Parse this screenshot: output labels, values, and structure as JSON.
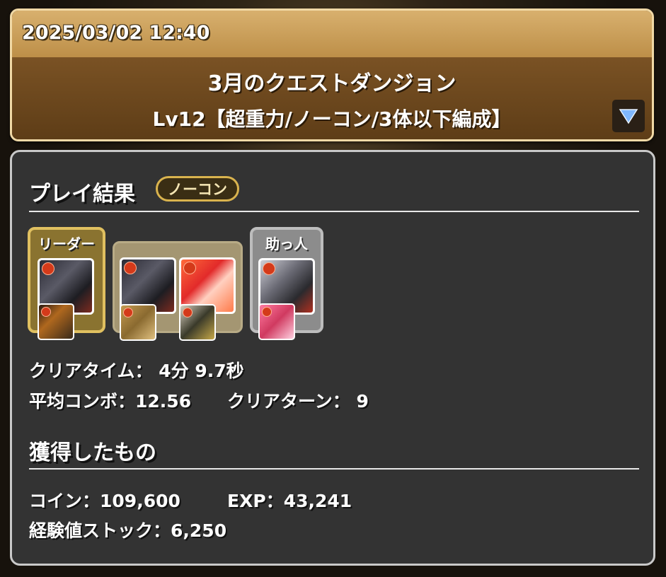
{
  "header": {
    "datetime": "2025/03/02 12:40",
    "quest_title": "3月のクエストダンジョン",
    "quest_subtitle": "Lv12【超重力/ノーコン/3体以下編成】",
    "dropdown_icon": "triangle-down-icon"
  },
  "result": {
    "title": "プレイ結果",
    "badge": "ノーコン",
    "team": {
      "leader_label": "リーダー",
      "helper_label": "助っ人"
    },
    "clear_time_label": "クリアタイム：",
    "clear_time_value": "4分 9.7秒",
    "avg_combo_label": "平均コンボ：",
    "avg_combo_value": "12.56",
    "clear_turns_label": "クリアターン：",
    "clear_turns_value": "9"
  },
  "rewards": {
    "title": "獲得したもの",
    "coin_label": "コイン：",
    "coin_value": "109,600",
    "exp_label": "EXP：",
    "exp_value": "43,241",
    "exp_stock_label": "経験値ストック：",
    "exp_stock_value": "6,250"
  },
  "colors": {
    "header_top": "#c99a52",
    "header_bottom": "#6b4720",
    "panel_bg": "#333333",
    "badge_border": "#d9b34e"
  }
}
